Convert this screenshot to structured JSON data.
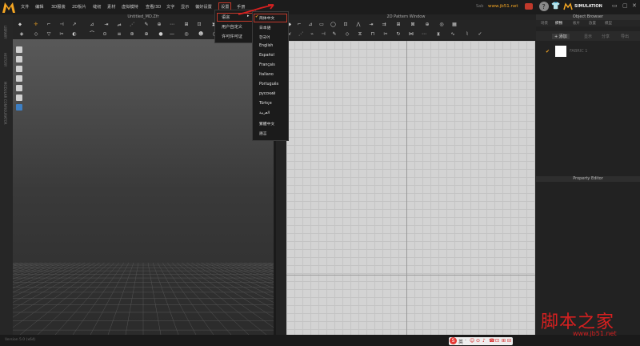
{
  "menubar": {
    "items": [
      "文件",
      "编辑",
      "3D服装",
      "2D板片",
      "缝纫",
      "素材",
      "虚拟模特",
      "查看/3D",
      "文字",
      "显示",
      "偏好设置",
      "设置",
      "手册"
    ],
    "user_prefix": "Sab",
    "user_text": "www.jb51.net",
    "mode_label": "SIMULATION",
    "colors": {
      "accent": "#f5a623",
      "active_border": "#c0392b"
    }
  },
  "left_strip": {
    "labels": [
      "LIBRARY",
      "HISTORY",
      "MODULAR CONFIGURATOR"
    ]
  },
  "view3d": {
    "title": "Untitled_MD.Zfr"
  },
  "view2d": {
    "title": "2D Pattern Window"
  },
  "right_panel": {
    "object_browser_title": "Object Browser",
    "tabs": [
      "场景",
      "织物",
      "板片",
      "放置",
      "模型"
    ],
    "add_label": "+ 添加",
    "sub_tabs": [
      "显示",
      "分享",
      "导出"
    ],
    "fabric_item": "FABRIC 1",
    "property_editor_title": "Property Editor"
  },
  "status": {
    "version": "Version 5.0 (x64)"
  },
  "dropdown_settings": {
    "items": [
      "语言",
      "用户自定义",
      "许可许可证"
    ]
  },
  "dropdown_language": {
    "items": [
      "简体中文",
      "日本語",
      "한국어",
      "English",
      "Español",
      "Français",
      "Italiano",
      "Português",
      "русский",
      "Türkçe",
      "العربية",
      "繁體中文",
      "語言"
    ],
    "checked": "简体中文"
  },
  "watermark": {
    "text": "脚本之家",
    "url": "www.jb51.net"
  },
  "tray": {
    "icons": [
      "S",
      "英",
      "·",
      "☺",
      "⊙",
      "♪",
      "☎",
      "⊡",
      "⊞",
      "⊟"
    ]
  }
}
